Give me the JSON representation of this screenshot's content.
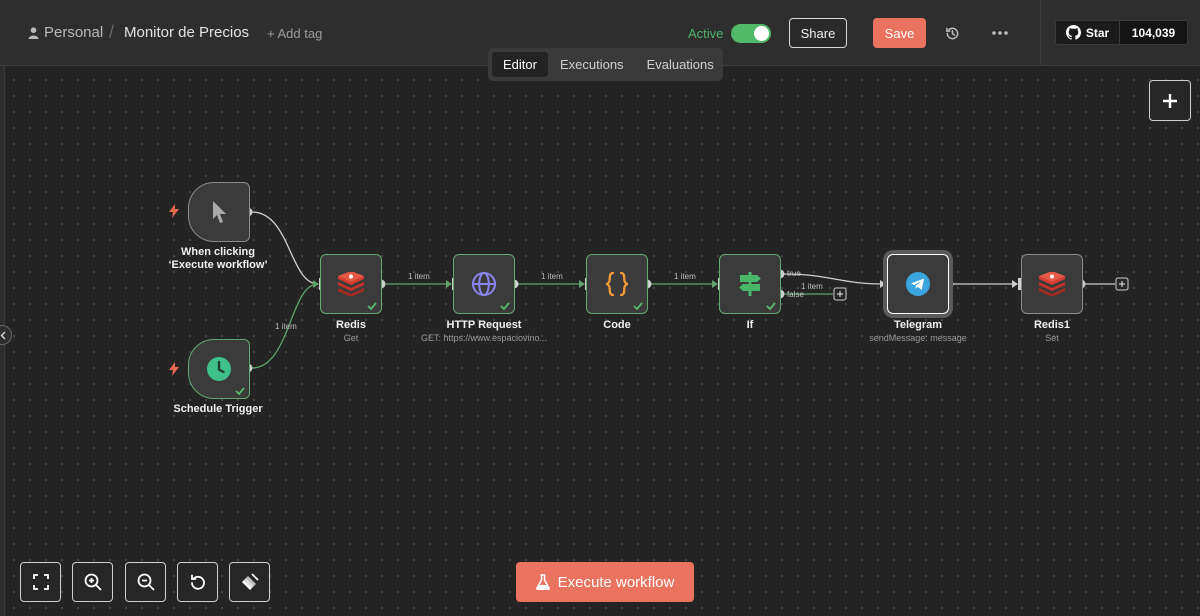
{
  "header": {
    "breadcrumb_project": "Personal",
    "breadcrumb_sep": "/",
    "workflow_title": "Monitor de Precios",
    "add_tag": "+ Add tag",
    "active_label": "Active",
    "active_on": true,
    "share_label": "Share",
    "save_label": "Save",
    "github_star_label": "Star",
    "github_star_count": "104,039"
  },
  "tabs": [
    {
      "label": "Editor",
      "selected": true
    },
    {
      "label": "Executions",
      "selected": false
    },
    {
      "label": "Evaluations",
      "selected": false
    }
  ],
  "nodes": {
    "manual_trigger": {
      "label": "When clicking ‘Execute workflow’",
      "icon": "cursor-pointer-icon"
    },
    "schedule_trigger": {
      "label": "Schedule Trigger",
      "icon": "clock-icon"
    },
    "redis": {
      "label": "Redis",
      "sub": "Get",
      "icon": "redis-icon"
    },
    "http_request": {
      "label": "HTTP Request",
      "sub": "GET: https://www.espaciovino...",
      "icon": "globe-icon"
    },
    "code": {
      "label": "Code",
      "icon": "braces-icon"
    },
    "if": {
      "label": "If",
      "icon": "signpost-icon"
    },
    "telegram": {
      "label": "Telegram",
      "sub": "sendMessage: message",
      "icon": "telegram-icon"
    },
    "redis1": {
      "label": "Redis1",
      "sub": "Set",
      "icon": "redis-icon"
    }
  },
  "edges": {
    "schedule_to_redis": "1 item",
    "redis_to_http": "1 item",
    "http_to_code": "1 item",
    "code_to_if": "1 item",
    "if_true": "true",
    "if_false": "false",
    "if_false_items": "1 item"
  },
  "footer": {
    "execute_label": "Execute workflow"
  },
  "colors": {
    "accent": "#e9735f",
    "success": "#52b96a",
    "canvas": "#242424"
  }
}
